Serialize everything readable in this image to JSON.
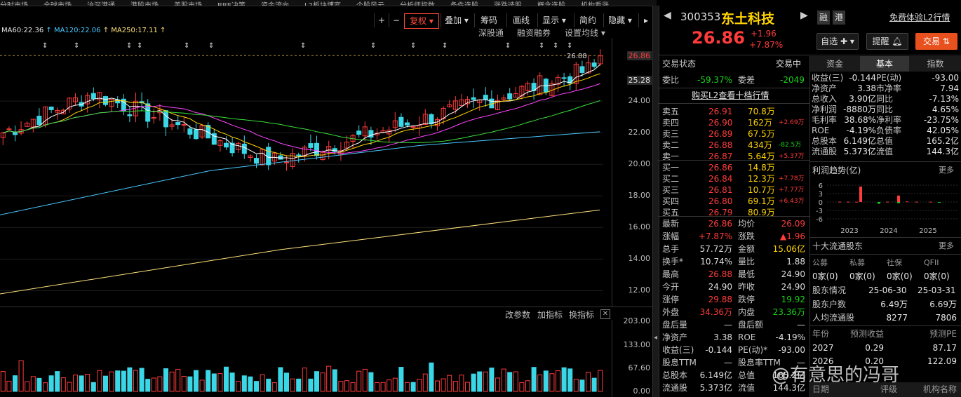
{
  "top_menu": [
    "分时市场",
    "全球市场",
    "沪深港通",
    "港股市场",
    "美股市场",
    "BBE决策",
    "资金流向",
    "L2板块博弈",
    "个股风云",
    "分析师指数",
    "条件选股",
    "涨跌选股",
    "概念选股",
    "机构看涨",
    "高级选股",
    "选股器",
    "机构看跌",
    "机构推荐",
    "打开导航",
    "返回"
  ],
  "toolbar": {
    "plus": "+",
    "minus": "−",
    "fuquan": "复权",
    "diejia": "叠加",
    "chouma": "筹码",
    "huaxian": "画线",
    "xianshi": "显示",
    "jianyue": "简约",
    "yincang": "隐藏"
  },
  "ma_legend": [
    {
      "label": "MA60:22.36",
      "color": "#e6e6e6"
    },
    {
      "label": "MA120:22.06",
      "color": "#49c8ff"
    },
    {
      "label": "MA250:17.11",
      "color": "#ffe27a"
    }
  ],
  "chart_sub": {
    "shentong": "深股通",
    "rongzi": "融资融券",
    "ma_setting": "设置均线"
  },
  "price_axis": [
    "26.86",
    "25.28",
    "24.00",
    "22.00",
    "20.00",
    "18.00",
    "16.00",
    "14.00",
    "12.00"
  ],
  "high_marker": "26.88",
  "vol_tools": {
    "gaican": "改参数",
    "jiazhibiao": "加指标",
    "huanzhibiao": "换指标"
  },
  "vol_axis": [
    "203.00",
    "133.00",
    "67.60",
    "0.00"
  ],
  "stock": {
    "code": "300353",
    "name": "东土科技",
    "price": "26.86",
    "change": "+1.96",
    "pct": "+7.87%",
    "rong": "融",
    "gang": "港",
    "l2_link": "免费体验L2行情"
  },
  "buttons": {
    "zixuan": "自选",
    "tixing": "提醒",
    "jiaoyi": "交易"
  },
  "trade": {
    "status_label": "交易状态",
    "status": "交易中",
    "weibi_label": "委比",
    "weibi": "-59.37%",
    "weicha_label": "委差",
    "weicha": "-2049",
    "l2_buy": "购买L2查看十档行情"
  },
  "sells": [
    {
      "label": "卖五",
      "price": "26.91",
      "vol": "70.8万",
      "chg": ""
    },
    {
      "label": "卖四",
      "price": "26.90",
      "vol": "162万",
      "chg": "+2.69万"
    },
    {
      "label": "卖三",
      "price": "26.89",
      "vol": "67.5万",
      "chg": ""
    },
    {
      "label": "卖二",
      "price": "26.88",
      "vol": "434万",
      "chg": "-82.5万"
    },
    {
      "label": "卖一",
      "price": "26.87",
      "vol": "5.64万",
      "chg": "+5.37万"
    }
  ],
  "buys": [
    {
      "label": "买一",
      "price": "26.86",
      "vol": "14.8万",
      "chg": ""
    },
    {
      "label": "买二",
      "price": "26.84",
      "vol": "12.3万",
      "chg": "+7.78万"
    },
    {
      "label": "买三",
      "price": "26.81",
      "vol": "10.7万",
      "chg": "+7.77万"
    },
    {
      "label": "买四",
      "price": "26.80",
      "vol": "69.1万",
      "chg": "+6.43万"
    },
    {
      "label": "买五",
      "price": "26.79",
      "vol": "80.9万",
      "chg": ""
    }
  ],
  "quote": [
    [
      "最新",
      "26.86",
      "均价",
      "26.09"
    ],
    [
      "涨幅",
      "+7.87%",
      "涨跌",
      "▲1.96"
    ],
    [
      "总手",
      "57.72万",
      "金额",
      "15.06亿"
    ],
    [
      "换手*",
      "10.74%",
      "量比",
      "1.88"
    ],
    [
      "最高",
      "26.88",
      "最低",
      "24.90"
    ],
    [
      "今开",
      "24.90",
      "昨收",
      "24.90"
    ],
    [
      "涨停",
      "29.88",
      "跌停",
      "19.92"
    ],
    [
      "外盘",
      "34.36万",
      "内盘",
      "23.36万"
    ],
    [
      "盘后量",
      "—",
      "盘后额",
      "—"
    ],
    [
      "净资产",
      "3.38",
      "ROE",
      "-4.19%"
    ],
    [
      "收益(三)",
      "-0.144",
      "PE(动)*",
      "-93.00"
    ],
    [
      "股息TTM",
      "—",
      "股息率TTM",
      "—"
    ],
    [
      "总股本",
      "6.149亿",
      "总值",
      "165.2亿"
    ],
    [
      "流通股",
      "5.373亿",
      "流值",
      "144.3亿"
    ]
  ],
  "right_tabs": [
    "资金",
    "基本",
    "指数"
  ],
  "fin": [
    [
      "收益(三)",
      "-0.144",
      "PE(动)",
      "-93.00"
    ],
    [
      "净资产",
      "3.38",
      "市净率",
      "7.94"
    ],
    [
      "总收入",
      "3.90亿",
      "同比",
      "-7.13%"
    ],
    [
      "净利润",
      "-8880万",
      "同比",
      "4.65%"
    ],
    [
      "毛利率",
      "38.68%",
      "净利率",
      "-23.75%"
    ],
    [
      "ROE",
      "-4.19%",
      "负债率",
      "42.05%"
    ],
    [
      "总股本",
      "6.149亿",
      "总值",
      "165.2亿"
    ],
    [
      "流通股",
      "5.373亿",
      "流值",
      "144.3亿"
    ]
  ],
  "profit_trend": {
    "title": "利润趋势(亿)",
    "more": "更多",
    "yaxis": [
      "6",
      "3",
      "0",
      "-3",
      "-6"
    ],
    "years": [
      "2023",
      "2024",
      "2025"
    ]
  },
  "top10": {
    "title": "十大流通股东",
    "more": "更多",
    "cols": [
      "公募",
      "私募",
      "社保",
      "QFII"
    ],
    "vals": [
      "0家(0)",
      "0家(0)",
      "0家(0)",
      "0家(0)"
    ]
  },
  "holders": {
    "label": "股东情况",
    "d1": "25-06-30",
    "d2": "25-03-31",
    "rows": [
      [
        "股东户数",
        "6.49万",
        "6.69万"
      ],
      [
        "人均流通股",
        "8277",
        "7806"
      ]
    ]
  },
  "forecast": {
    "cols": [
      "年份",
      "预测收益",
      "预测PE"
    ],
    "rows": [
      [
        "2027",
        "0.29",
        "87.17"
      ],
      [
        "2026",
        "0.20",
        "122.09"
      ]
    ],
    "footer": [
      "日期",
      "评级",
      "机构名称"
    ]
  },
  "watermark": "@有意思的冯哥",
  "chart_data": {
    "type": "candlestick",
    "ma": [
      {
        "name": "MA60",
        "value": 22.36
      },
      {
        "name": "MA120",
        "value": 22.06
      },
      {
        "name": "MA250",
        "value": 17.11
      }
    ],
    "ylim": [
      11,
      28
    ],
    "last_close": 26.86,
    "high": 26.88,
    "vol_ylim": [
      0,
      203
    ]
  }
}
